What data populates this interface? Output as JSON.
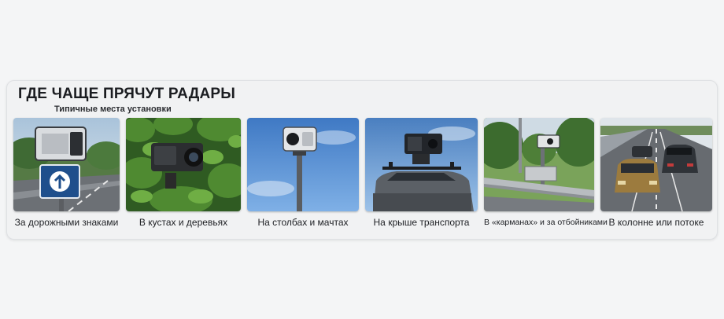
{
  "header": {
    "title": "ГДЕ ЧАЩЕ ПРЯЧУТ РАДАРЫ",
    "subtitle": "Типичные места установки"
  },
  "locations": [
    {
      "caption": "За дорожными знаками",
      "icon": "camera-behind-road-sign"
    },
    {
      "caption": "В кустах и деревьях",
      "icon": "camera-in-bushes"
    },
    {
      "caption": "На столбах и мачтах",
      "icon": "camera-on-pole"
    },
    {
      "caption": "На крыше транспорта",
      "icon": "camera-on-car-roof"
    },
    {
      "caption": "В «карманах» и за отбойниками",
      "icon": "camera-behind-guardrail"
    },
    {
      "caption": "В колонне или потоке",
      "icon": "camera-in-traffic"
    }
  ]
}
